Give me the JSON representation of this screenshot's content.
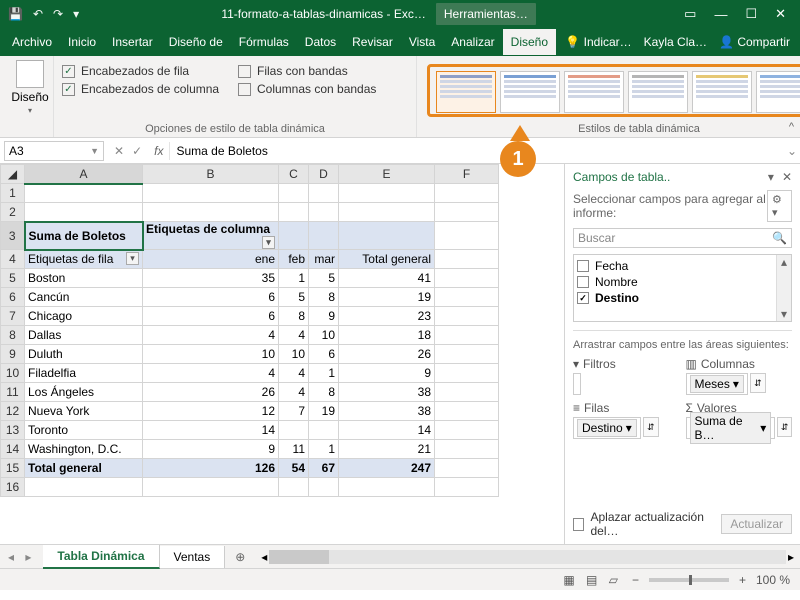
{
  "titlebar": {
    "doc": "11-formato-a-tablas-dinamicas - Exc…",
    "tools": "Herramientas…"
  },
  "menus": {
    "archivo": "Archivo",
    "inicio": "Inicio",
    "insertar": "Insertar",
    "diseno_de": "Diseño de",
    "formulas": "Fórmulas",
    "datos": "Datos",
    "revisar": "Revisar",
    "vista": "Vista",
    "analizar": "Analizar",
    "diseno": "Diseño",
    "indicar": "Indicar…",
    "user": "Kayla Cla…",
    "compartir": "Compartir"
  },
  "ribbon": {
    "diseno_btn": "Diseño",
    "chk_enc_fila": "Encabezados de fila",
    "chk_filas_bandas": "Filas con bandas",
    "chk_enc_col": "Encabezados de columna",
    "chk_col_bandas": "Columnas con bandas",
    "grp_opts": "Opciones de estilo de tabla dinámica",
    "grp_styles": "Estilos de tabla dinámica"
  },
  "callout": "1",
  "namebox": "A3",
  "formula": "Suma de Boletos",
  "cols": {
    "A": "A",
    "B": "B",
    "C": "C",
    "D": "D",
    "E": "E",
    "F": "F"
  },
  "pivot": {
    "sum": "Suma de Boletos",
    "col_lbl": "Etiquetas de columna",
    "row_lbl": "Etiquetas de fila",
    "ene": "ene",
    "feb": "feb",
    "mar": "mar",
    "tot": "Total general",
    "rows": [
      {
        "n": "Boston",
        "v": [
          "35",
          "1",
          "5",
          "41"
        ]
      },
      {
        "n": "Cancún",
        "v": [
          "6",
          "5",
          "8",
          "19"
        ]
      },
      {
        "n": "Chicago",
        "v": [
          "6",
          "8",
          "9",
          "23"
        ]
      },
      {
        "n": "Dallas",
        "v": [
          "4",
          "4",
          "10",
          "18"
        ]
      },
      {
        "n": "Duluth",
        "v": [
          "10",
          "10",
          "6",
          "26"
        ]
      },
      {
        "n": "Filadelfia",
        "v": [
          "4",
          "4",
          "1",
          "9"
        ]
      },
      {
        "n": "Los Ángeles",
        "v": [
          "26",
          "4",
          "8",
          "38"
        ]
      },
      {
        "n": "Nueva York",
        "v": [
          "12",
          "7",
          "19",
          "38"
        ]
      },
      {
        "n": "Toronto",
        "v": [
          "14",
          "",
          "",
          "14"
        ]
      },
      {
        "n": "Washington, D.C.",
        "v": [
          "9",
          "11",
          "1",
          "21"
        ]
      }
    ],
    "grand": [
      "126",
      "54",
      "67",
      "247"
    ]
  },
  "pane": {
    "title": "Campos de tabla..",
    "sub": "Seleccionar campos para agregar al informe:",
    "search": "Buscar",
    "fields": {
      "fecha": "Fecha",
      "nombre": "Nombre",
      "destino": "Destino"
    },
    "drag": "Arrastrar campos entre las áreas siguientes:",
    "filters": "Filtros",
    "cols": "Columnas",
    "rows": "Filas",
    "vals": "Valores",
    "meses": "Meses",
    "destino_p": "Destino",
    "suma_p": "Suma de B…",
    "defer": "Aplazar actualización del…",
    "update": "Actualizar"
  },
  "sheets": {
    "s1": "Tabla Dinámica",
    "s2": "Ventas"
  },
  "status": {
    "zoom": "100 %"
  }
}
